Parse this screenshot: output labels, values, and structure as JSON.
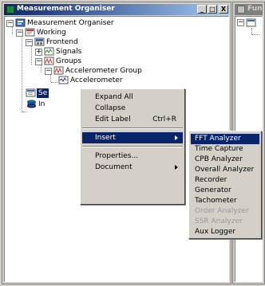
{
  "main_window": {
    "title": "Measurement Organiser",
    "minimize": "_",
    "maximize": "□",
    "close": "X"
  },
  "func_window": {
    "title": "Fun"
  },
  "tree": {
    "root": "Measurement Organiser",
    "working": "Working",
    "frontend": "Frontend",
    "signals": "Signals",
    "groups": "Groups",
    "accel_group": "Accelerometer Group",
    "accelerometer": "Accelerometer",
    "selected_partial": "Se",
    "input_partial": "In"
  },
  "context_menu": {
    "expand_all": "Expand All",
    "collapse": "Collapse",
    "edit_label": "Edit Label",
    "edit_label_shortcut": "Ctrl+R",
    "insert": "Insert",
    "properties": "Properties...",
    "document": "Document"
  },
  "insert_submenu": {
    "items": [
      {
        "label": "FFT Analyzer",
        "enabled": true,
        "selected": true
      },
      {
        "label": "Time Capture",
        "enabled": true
      },
      {
        "label": "CPB Analyzer",
        "enabled": true
      },
      {
        "label": "Overall Analyzer",
        "enabled": true
      },
      {
        "label": "Recorder",
        "enabled": true
      },
      {
        "label": "Generator",
        "enabled": true
      },
      {
        "label": "Tachometer",
        "enabled": true
      },
      {
        "label": "Order Analyzer",
        "enabled": false
      },
      {
        "label": "SSR Analyzer",
        "enabled": false
      },
      {
        "label": "Aux Logger",
        "enabled": true
      }
    ]
  }
}
